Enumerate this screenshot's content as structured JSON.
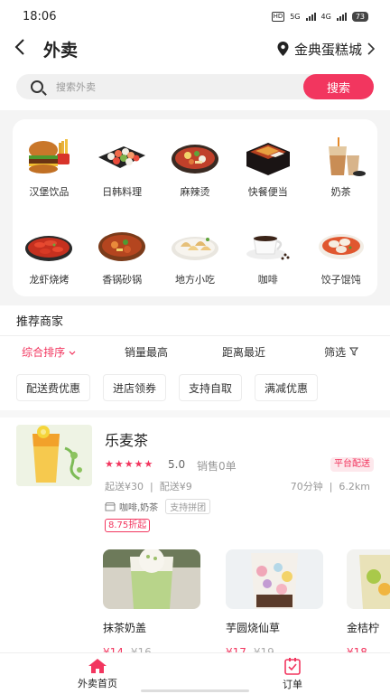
{
  "status": {
    "time": "18:06",
    "hd": "HD",
    "net1": "5G",
    "net2": "4G",
    "battery": "73"
  },
  "header": {
    "title": "外卖",
    "location": "金典蛋糕城"
  },
  "search": {
    "placeholder": "搜索外卖",
    "button": "搜索"
  },
  "categories": [
    {
      "label": "汉堡饮品",
      "icon": "burger-icon"
    },
    {
      "label": "日韩料理",
      "icon": "sushi-icon"
    },
    {
      "label": "麻辣烫",
      "icon": "malatang-icon"
    },
    {
      "label": "快餐便当",
      "icon": "bento-icon"
    },
    {
      "label": "奶茶",
      "icon": "milk-tea-icon"
    },
    {
      "label": "龙虾烧烤",
      "icon": "crayfish-icon"
    },
    {
      "label": "香锅砂锅",
      "icon": "hotpot-icon"
    },
    {
      "label": "地方小吃",
      "icon": "dumpling-plate-icon"
    },
    {
      "label": "咖啡",
      "icon": "coffee-icon"
    },
    {
      "label": "饺子馄饨",
      "icon": "wonton-icon"
    }
  ],
  "section": {
    "title": "推荐商家"
  },
  "sort": {
    "comprehensive": "综合排序",
    "sales": "销量最高",
    "distance": "距离最近",
    "filter": "筛选"
  },
  "filters": [
    "配送费优惠",
    "进店领券",
    "支持自取",
    "满减优惠"
  ],
  "shop": {
    "name": "乐麦茶",
    "rating": "5.0",
    "rating_value": 5,
    "sales": "销售0单",
    "badge": "平台配送",
    "min_order": "起送¥30",
    "delivery_fee": "配送¥9",
    "time": "70分钟",
    "distance": "6.2km",
    "cuisine": "咖啡,奶茶",
    "group": "支持拼团",
    "discount": "8.75折起",
    "items": [
      {
        "name": "抹茶奶盖",
        "price": "¥14",
        "original": "¥16"
      },
      {
        "name": "芋圆烧仙草",
        "price": "¥17",
        "original": "¥19"
      },
      {
        "name": "金桔柠",
        "price": "¥18",
        "original": ""
      }
    ]
  },
  "nav": {
    "home": "外卖首页",
    "orders": "订单"
  },
  "colors": {
    "accent": "#f2365f"
  }
}
